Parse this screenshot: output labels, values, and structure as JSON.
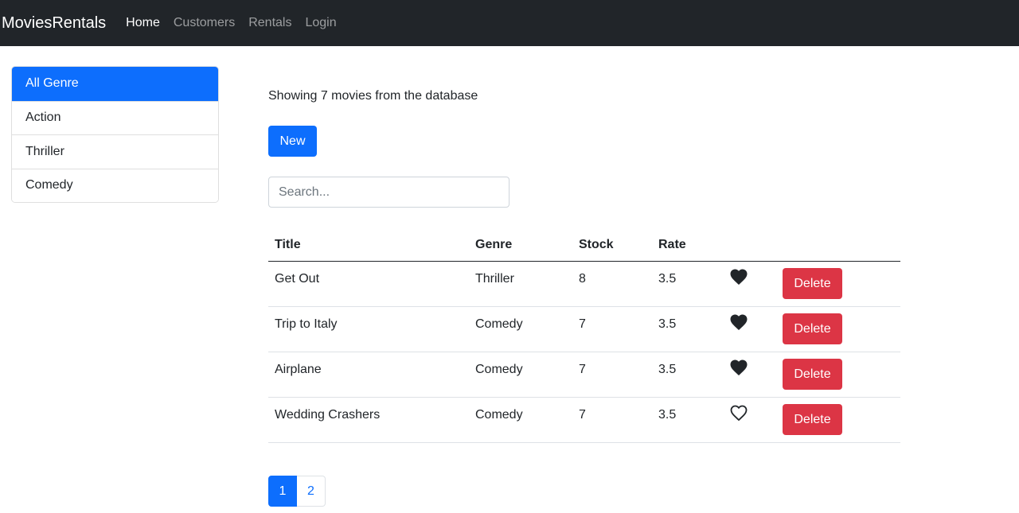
{
  "navbar": {
    "brand": "MoviesRentals",
    "links": [
      {
        "label": "Home",
        "active": true
      },
      {
        "label": "Customers",
        "active": false
      },
      {
        "label": "Rentals",
        "active": false
      },
      {
        "label": "Login",
        "active": false
      }
    ]
  },
  "sidebar": {
    "genres": [
      {
        "label": "All Genre",
        "active": true
      },
      {
        "label": "Action",
        "active": false
      },
      {
        "label": "Thriller",
        "active": false
      },
      {
        "label": "Comedy",
        "active": false
      }
    ]
  },
  "main": {
    "count_text": "Showing 7 movies from the database",
    "new_button_label": "New",
    "search_placeholder": "Search...",
    "table": {
      "headers": {
        "title": "Title",
        "genre": "Genre",
        "stock": "Stock",
        "rate": "Rate"
      },
      "delete_label": "Delete",
      "rows": [
        {
          "title": "Get Out",
          "genre": "Thriller",
          "stock": "8",
          "rate": "3.5",
          "liked": true
        },
        {
          "title": "Trip to Italy",
          "genre": "Comedy",
          "stock": "7",
          "rate": "3.5",
          "liked": true
        },
        {
          "title": "Airplane",
          "genre": "Comedy",
          "stock": "7",
          "rate": "3.5",
          "liked": true
        },
        {
          "title": "Wedding Crashers",
          "genre": "Comedy",
          "stock": "7",
          "rate": "3.5",
          "liked": false
        }
      ]
    },
    "pagination": {
      "pages": [
        "1",
        "2"
      ],
      "current": "1"
    }
  },
  "icons": {
    "liked": "heart-filled-icon",
    "not_liked": "heart-outline-icon"
  },
  "colors": {
    "navbar_bg": "#212529",
    "primary": "#0d6efd",
    "danger": "#dc3545",
    "text": "#212529"
  }
}
